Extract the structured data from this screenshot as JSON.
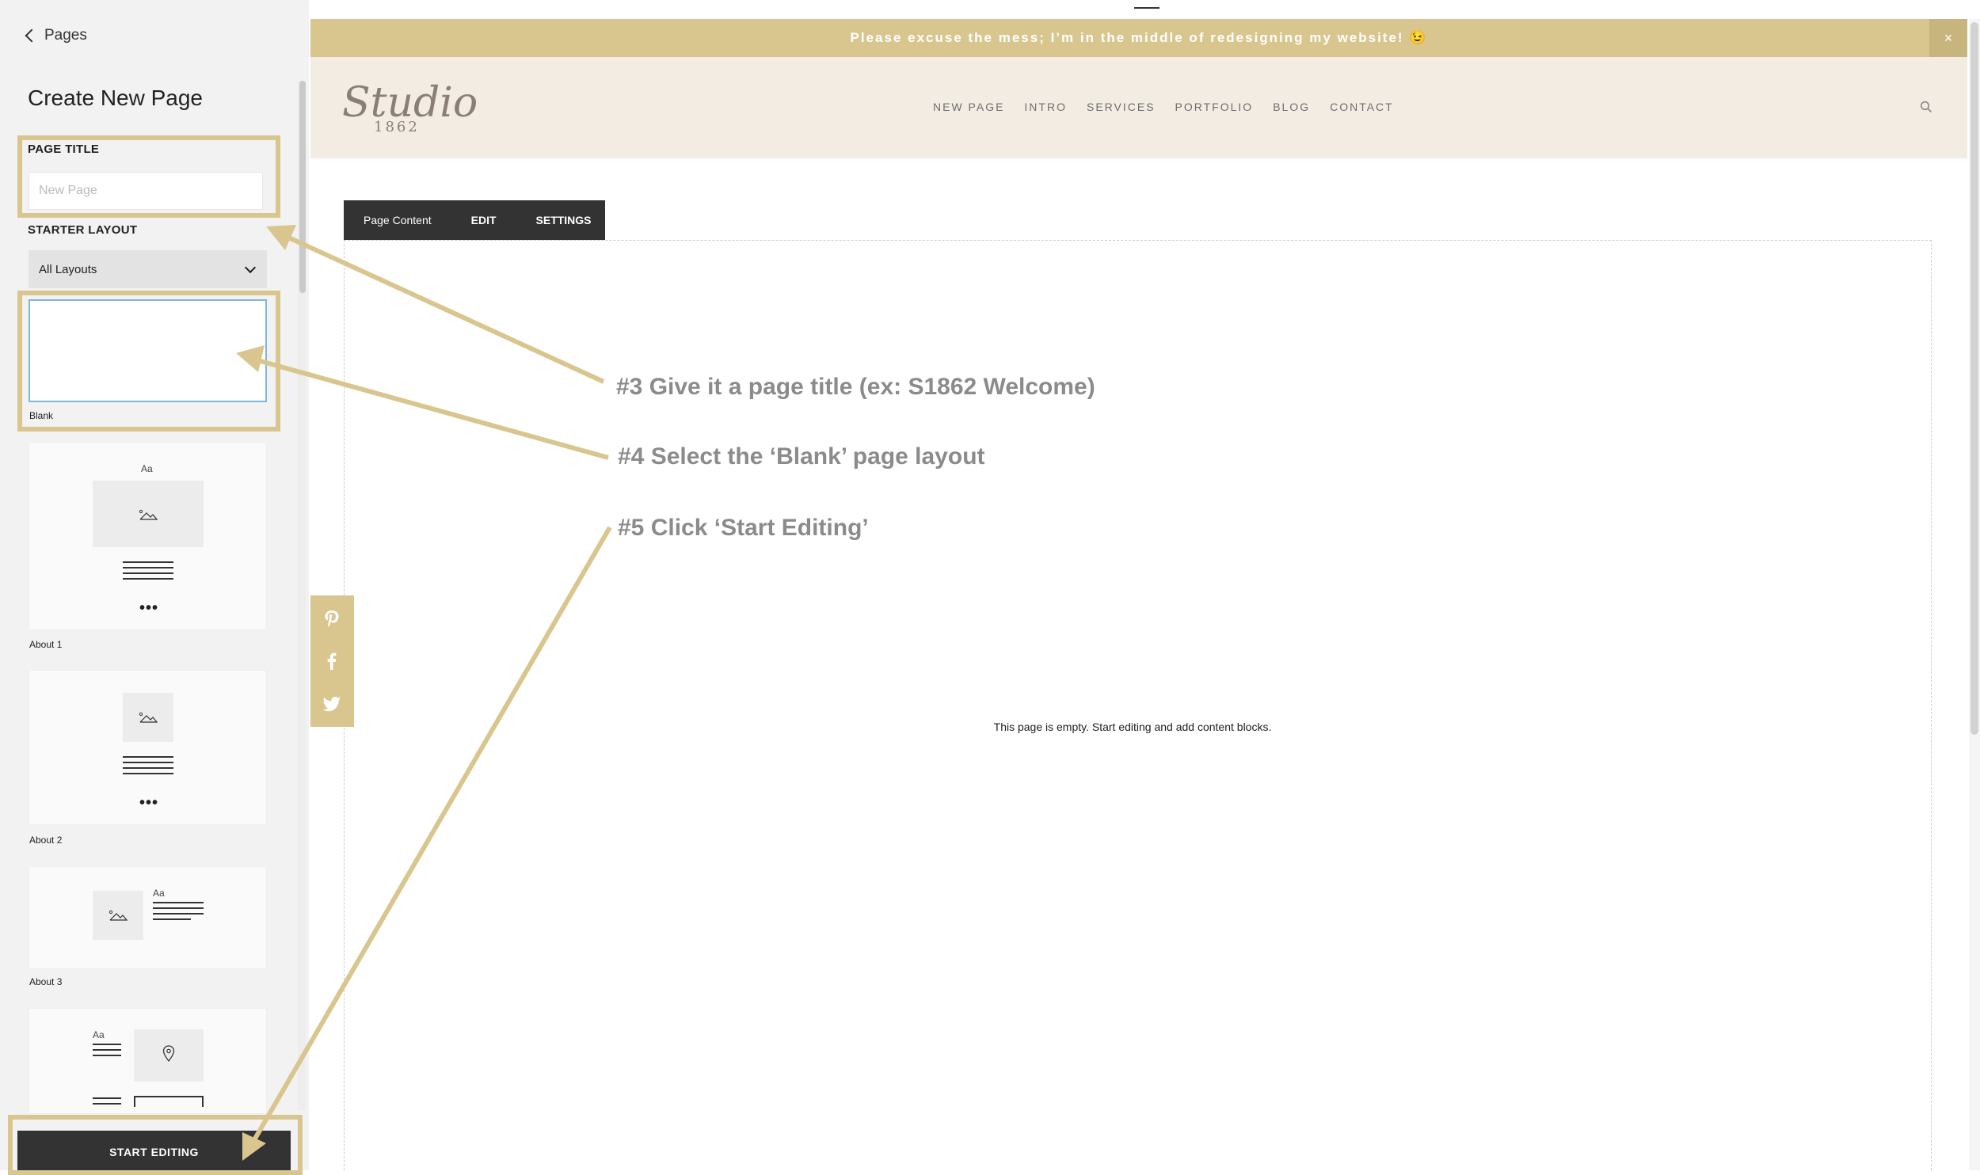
{
  "sidebar": {
    "back_label": "Pages",
    "title": "Create New Page",
    "page_title_label": "PAGE TITLE",
    "page_title_placeholder": "New Page",
    "starter_layout_label": "STARTER LAYOUT",
    "layout_filter": "All Layouts",
    "layouts": [
      {
        "label": "Blank"
      },
      {
        "label": "About 1",
        "thumb_text": "Aa"
      },
      {
        "label": "About 2"
      },
      {
        "label": "About 3",
        "thumb_text": "Aa"
      },
      {
        "thumb_text": "Aa"
      }
    ],
    "start_button": "START EDITING"
  },
  "site": {
    "announcement": "Please excuse the mess; I’m in the middle of redesigning my website! 😉",
    "close_label": "×",
    "logo_main": "Studio",
    "logo_sub": "1862",
    "nav": [
      "NEW PAGE",
      "INTRO",
      "SERVICES",
      "PORTFOLIO",
      "BLOG",
      "CONTACT"
    ]
  },
  "page_toolbar": {
    "content_label": "Page Content",
    "edit_label": "EDIT",
    "settings_label": "SETTINGS"
  },
  "empty_message": "This page is empty. Start editing and add content blocks.",
  "share_icons": [
    "pinterest-icon",
    "facebook-icon",
    "twitter-icon"
  ],
  "annotations": {
    "step3": "#3 Give it a page title (ex: S1862 Welcome)",
    "step4": "#4 Select the ‘Blank’ page layout",
    "step5": "#5 Click ‘Start Editing’"
  },
  "colors": {
    "accent": "#d9c68f",
    "header_bg": "#f3ece3",
    "toolbar_bg": "#333333",
    "annotation_text": "#8b8b8b"
  }
}
